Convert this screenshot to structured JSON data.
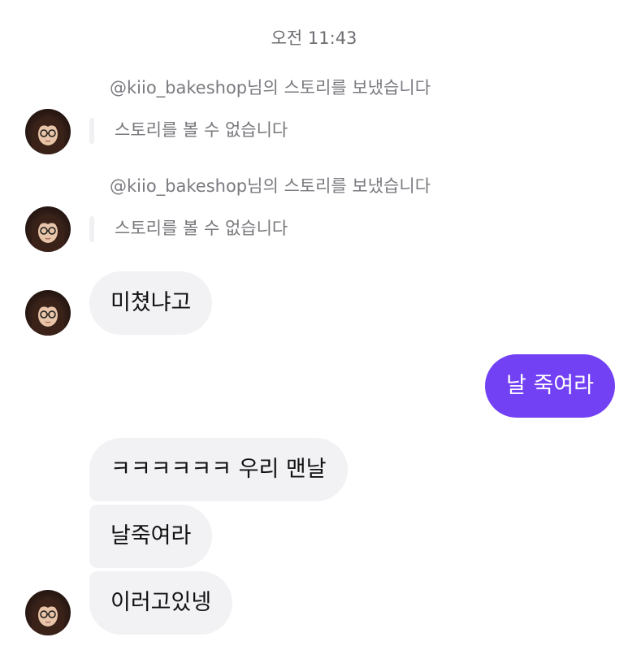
{
  "chat": {
    "timestamp": "오전 11:43",
    "avatar_icon": "user-avatar-icon",
    "colors": {
      "outgoing_bubble": "#7341f4",
      "incoming_bubble": "#f2f2f5"
    },
    "story_shares": [
      {
        "caption": "@kiio_bakeshop님의 스토리를 보냈습니다",
        "status": "스토리를 볼 수 없습니다"
      },
      {
        "caption": "@kiio_bakeshop님의 스토리를 보냈습니다",
        "status": "스토리를 볼 수 없습니다"
      }
    ],
    "messages": [
      {
        "sender": "them",
        "text": "미쳤냐고"
      },
      {
        "sender": "me",
        "text": "날 죽여라"
      },
      {
        "sender": "them",
        "text": "ㅋㅋㅋㅋㅋㅋ 우리 맨날"
      },
      {
        "sender": "them",
        "text": "날죽여라"
      },
      {
        "sender": "them",
        "text": "이러고있넹"
      }
    ]
  }
}
